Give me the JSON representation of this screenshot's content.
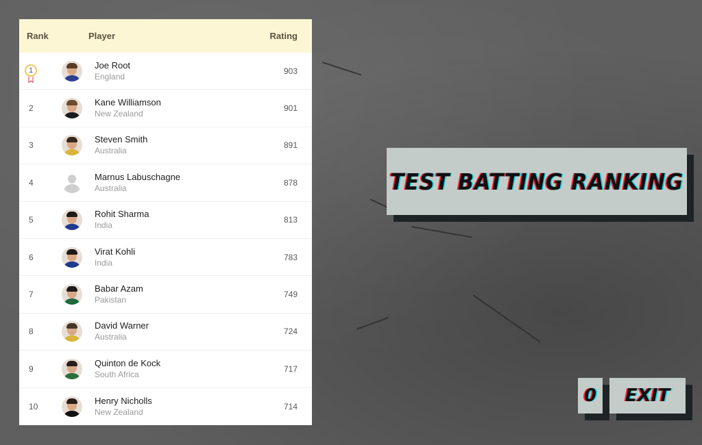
{
  "table": {
    "headers": {
      "rank": "Rank",
      "player": "Player",
      "rating": "Rating"
    },
    "rows": [
      {
        "rank": "1",
        "name": "Joe Root",
        "country": "England",
        "rating": "903",
        "shirt": "#2c3e8f",
        "hair": "#5a3b25"
      },
      {
        "rank": "2",
        "name": "Kane Williamson",
        "country": "New Zealand",
        "rating": "901",
        "shirt": "#1b1b1b",
        "hair": "#6b4a2e"
      },
      {
        "rank": "3",
        "name": "Steven Smith",
        "country": "Australia",
        "rating": "891",
        "shirt": "#d9b43a",
        "hair": "#3a2a1e"
      },
      {
        "rank": "4",
        "name": "Marnus Labuschagne",
        "country": "Australia",
        "rating": "878",
        "shirt": "#cfcfcf",
        "hair": "#cfcfcf"
      },
      {
        "rank": "5",
        "name": "Rohit Sharma",
        "country": "India",
        "rating": "813",
        "shirt": "#1e3c8c",
        "hair": "#1f1a17"
      },
      {
        "rank": "6",
        "name": "Virat Kohli",
        "country": "India",
        "rating": "783",
        "shirt": "#1e3c8c",
        "hair": "#1f1a17"
      },
      {
        "rank": "7",
        "name": "Babar Azam",
        "country": "Pakistan",
        "rating": "749",
        "shirt": "#1d6b3a",
        "hair": "#1f1a17"
      },
      {
        "rank": "8",
        "name": "David Warner",
        "country": "Australia",
        "rating": "724",
        "shirt": "#d9b43a",
        "hair": "#4a3426"
      },
      {
        "rank": "9",
        "name": "Quinton de Kock",
        "country": "South Africa",
        "rating": "717",
        "shirt": "#2a6e3c",
        "hair": "#2a1f18"
      },
      {
        "rank": "10",
        "name": "Henry Nicholls",
        "country": "New Zealand",
        "rating": "714",
        "shirt": "#111111",
        "hair": "#2a1f18"
      }
    ]
  },
  "title": "TEST BATTING RANKING",
  "buttons": {
    "zero": "0",
    "exit": "EXIT"
  },
  "colors": {
    "header_bg": "#fdf6d4",
    "card_bg": "#c4ccc9",
    "card_shadow": "#1e2325",
    "medal": "#f1c75b",
    "glitch_red": "#ff2a3a",
    "glitch_cyan": "#18d6e0"
  },
  "icons": {
    "placeholder": "user-silhouette-icon",
    "medal": "medal-ribbon-icon"
  }
}
